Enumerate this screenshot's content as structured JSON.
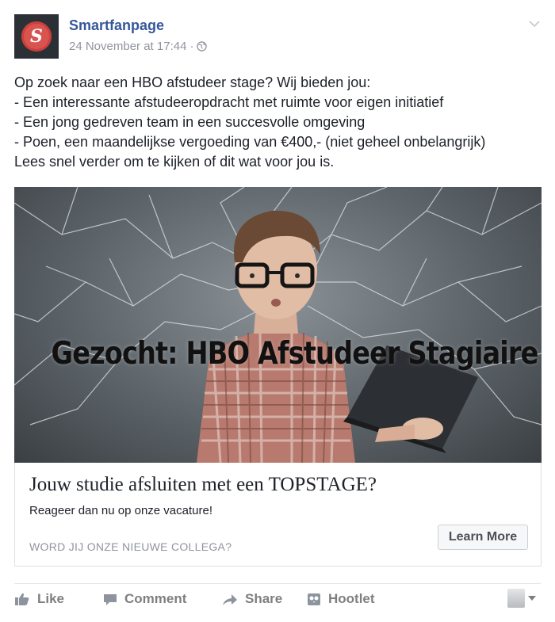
{
  "post": {
    "page_name": "Smartfanpage",
    "timestamp": "24 November at 17:44",
    "separator": "·",
    "privacy_icon": "globe-icon",
    "options_icon": "chevron-down-icon",
    "text_lines": [
      "Op zoek naar een HBO afstudeer stage? Wij bieden jou:",
      "- Een interessante afstudeeropdracht met ruimte voor eigen initiatief",
      "- Een jong gedreven team in een succesvolle omgeving",
      "- Poen, een maandelijkse vergoeding van €400,- (niet geheel onbelangrijk)",
      "Lees snel verder om te kijken of dit wat voor jou is."
    ]
  },
  "media": {
    "overlay_text": "Gezocht: HBO Afstudeer Stagiaire"
  },
  "link_card": {
    "title": "Jouw studie afsluiten met een TOPSTAGE?",
    "description": "Reageer dan nu op onze vacature!",
    "domain_text": "WORD JIJ ONZE NIEUWE COLLEGA?",
    "cta_label": "Learn More"
  },
  "actions": {
    "like": "Like",
    "comment": "Comment",
    "share": "Share",
    "hootlet": "Hootlet"
  },
  "colors": {
    "link_blue": "#365899",
    "meta_gray": "#90949c",
    "text": "#1d2129",
    "action_gray": "#7f7f7f"
  }
}
